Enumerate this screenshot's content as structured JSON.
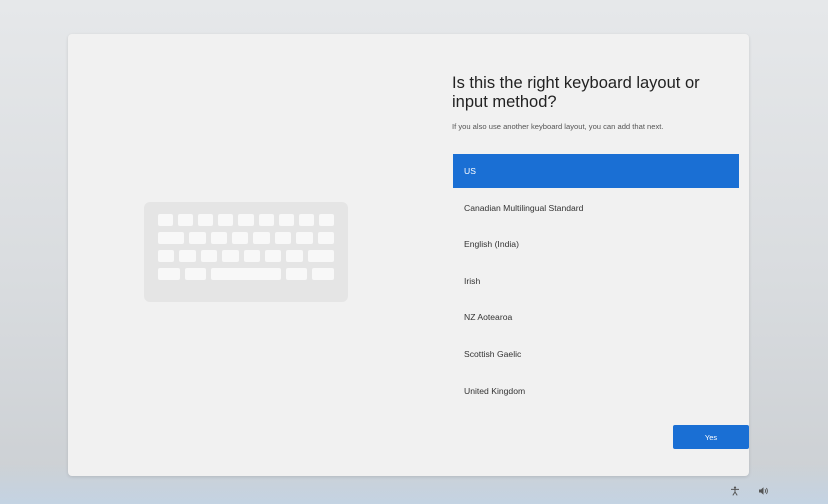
{
  "dialog": {
    "title": "Is this the right keyboard layout or input method?",
    "subtitle": "If you also use another keyboard layout, you can add that next."
  },
  "layouts": [
    {
      "label": "US",
      "selected": true
    },
    {
      "label": "Canadian Multilingual Standard",
      "selected": false
    },
    {
      "label": "English (India)",
      "selected": false
    },
    {
      "label": "Irish",
      "selected": false
    },
    {
      "label": "NZ Aotearoa",
      "selected": false
    },
    {
      "label": "Scottish Gaelic",
      "selected": false
    },
    {
      "label": "United Kingdom",
      "selected": false
    }
  ],
  "actions": {
    "yes_label": "Yes"
  },
  "tray": {
    "icons": [
      "accessibility-icon",
      "volume-icon"
    ]
  },
  "colors": {
    "accent": "#1a6fd4",
    "card": "#f1f1f1"
  }
}
